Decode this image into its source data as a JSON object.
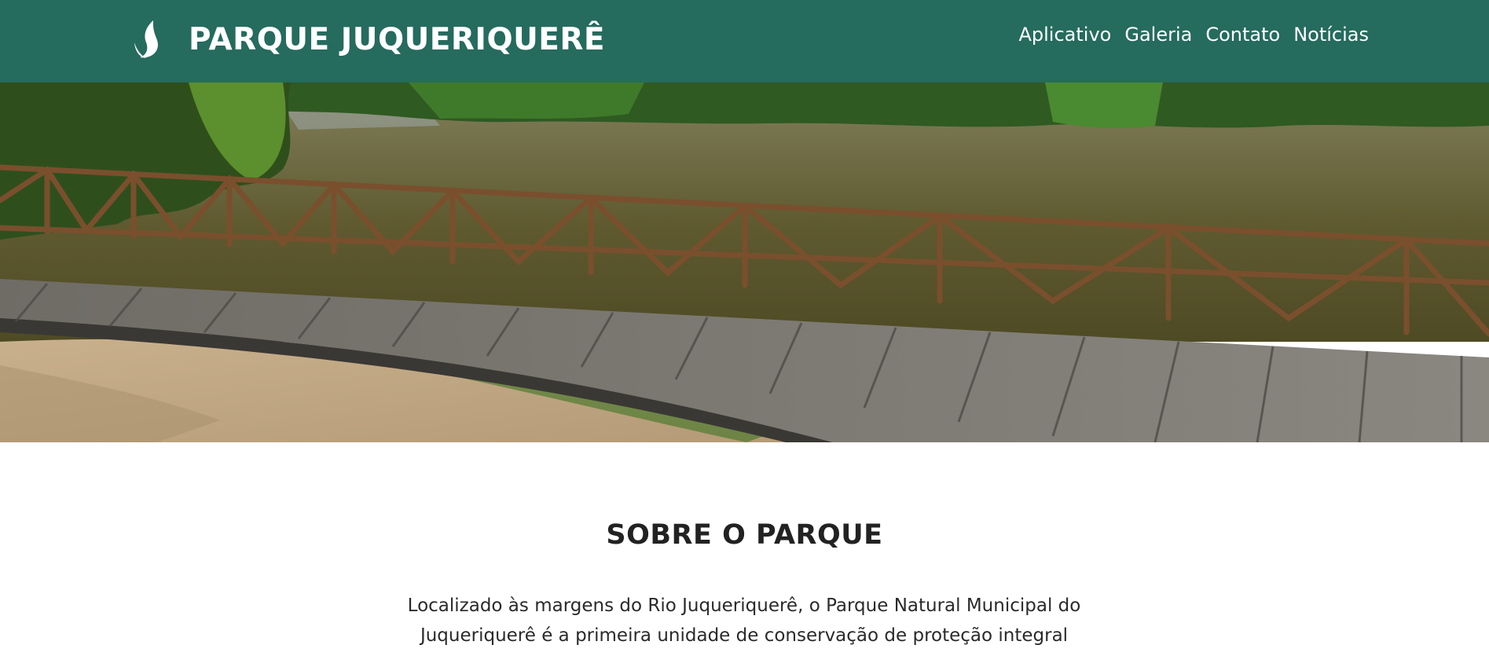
{
  "header": {
    "logo_icon": "leaf-drop-icon",
    "site_name": "PARQUE JUQUERIQUERÊ",
    "nav": [
      {
        "label": "Aplicativo"
      },
      {
        "label": "Galeria"
      },
      {
        "label": "Contato"
      },
      {
        "label": "Notícias"
      }
    ]
  },
  "hero": {
    "image_subject": "wooden boardwalk beside river"
  },
  "about": {
    "title": "SOBRE O PARQUE",
    "text": "Localizado às margens do Rio Juqueriquerê, o Parque Natural Municipal do Juqueriquerê é a primeira unidade de conservação de proteção integral"
  },
  "colors": {
    "header_bg": "#256b5e",
    "header_text": "#ffffff",
    "body_bg": "#ffffff",
    "title_text": "#222222"
  }
}
